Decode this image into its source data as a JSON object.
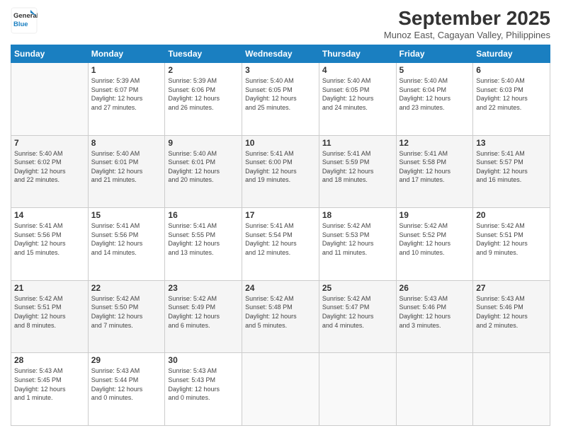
{
  "header": {
    "logo_line1": "General",
    "logo_line2": "Blue",
    "month_title": "September 2025",
    "subtitle": "Munoz East, Cagayan Valley, Philippines"
  },
  "columns": [
    "Sunday",
    "Monday",
    "Tuesday",
    "Wednesday",
    "Thursday",
    "Friday",
    "Saturday"
  ],
  "weeks": [
    [
      {
        "day": "",
        "info": ""
      },
      {
        "day": "1",
        "info": "Sunrise: 5:39 AM\nSunset: 6:07 PM\nDaylight: 12 hours\nand 27 minutes."
      },
      {
        "day": "2",
        "info": "Sunrise: 5:39 AM\nSunset: 6:06 PM\nDaylight: 12 hours\nand 26 minutes."
      },
      {
        "day": "3",
        "info": "Sunrise: 5:40 AM\nSunset: 6:05 PM\nDaylight: 12 hours\nand 25 minutes."
      },
      {
        "day": "4",
        "info": "Sunrise: 5:40 AM\nSunset: 6:05 PM\nDaylight: 12 hours\nand 24 minutes."
      },
      {
        "day": "5",
        "info": "Sunrise: 5:40 AM\nSunset: 6:04 PM\nDaylight: 12 hours\nand 23 minutes."
      },
      {
        "day": "6",
        "info": "Sunrise: 5:40 AM\nSunset: 6:03 PM\nDaylight: 12 hours\nand 22 minutes."
      }
    ],
    [
      {
        "day": "7",
        "info": "Sunrise: 5:40 AM\nSunset: 6:02 PM\nDaylight: 12 hours\nand 22 minutes."
      },
      {
        "day": "8",
        "info": "Sunrise: 5:40 AM\nSunset: 6:01 PM\nDaylight: 12 hours\nand 21 minutes."
      },
      {
        "day": "9",
        "info": "Sunrise: 5:40 AM\nSunset: 6:01 PM\nDaylight: 12 hours\nand 20 minutes."
      },
      {
        "day": "10",
        "info": "Sunrise: 5:41 AM\nSunset: 6:00 PM\nDaylight: 12 hours\nand 19 minutes."
      },
      {
        "day": "11",
        "info": "Sunrise: 5:41 AM\nSunset: 5:59 PM\nDaylight: 12 hours\nand 18 minutes."
      },
      {
        "day": "12",
        "info": "Sunrise: 5:41 AM\nSunset: 5:58 PM\nDaylight: 12 hours\nand 17 minutes."
      },
      {
        "day": "13",
        "info": "Sunrise: 5:41 AM\nSunset: 5:57 PM\nDaylight: 12 hours\nand 16 minutes."
      }
    ],
    [
      {
        "day": "14",
        "info": "Sunrise: 5:41 AM\nSunset: 5:56 PM\nDaylight: 12 hours\nand 15 minutes."
      },
      {
        "day": "15",
        "info": "Sunrise: 5:41 AM\nSunset: 5:56 PM\nDaylight: 12 hours\nand 14 minutes."
      },
      {
        "day": "16",
        "info": "Sunrise: 5:41 AM\nSunset: 5:55 PM\nDaylight: 12 hours\nand 13 minutes."
      },
      {
        "day": "17",
        "info": "Sunrise: 5:41 AM\nSunset: 5:54 PM\nDaylight: 12 hours\nand 12 minutes."
      },
      {
        "day": "18",
        "info": "Sunrise: 5:42 AM\nSunset: 5:53 PM\nDaylight: 12 hours\nand 11 minutes."
      },
      {
        "day": "19",
        "info": "Sunrise: 5:42 AM\nSunset: 5:52 PM\nDaylight: 12 hours\nand 10 minutes."
      },
      {
        "day": "20",
        "info": "Sunrise: 5:42 AM\nSunset: 5:51 PM\nDaylight: 12 hours\nand 9 minutes."
      }
    ],
    [
      {
        "day": "21",
        "info": "Sunrise: 5:42 AM\nSunset: 5:51 PM\nDaylight: 12 hours\nand 8 minutes."
      },
      {
        "day": "22",
        "info": "Sunrise: 5:42 AM\nSunset: 5:50 PM\nDaylight: 12 hours\nand 7 minutes."
      },
      {
        "day": "23",
        "info": "Sunrise: 5:42 AM\nSunset: 5:49 PM\nDaylight: 12 hours\nand 6 minutes."
      },
      {
        "day": "24",
        "info": "Sunrise: 5:42 AM\nSunset: 5:48 PM\nDaylight: 12 hours\nand 5 minutes."
      },
      {
        "day": "25",
        "info": "Sunrise: 5:42 AM\nSunset: 5:47 PM\nDaylight: 12 hours\nand 4 minutes."
      },
      {
        "day": "26",
        "info": "Sunrise: 5:43 AM\nSunset: 5:46 PM\nDaylight: 12 hours\nand 3 minutes."
      },
      {
        "day": "27",
        "info": "Sunrise: 5:43 AM\nSunset: 5:46 PM\nDaylight: 12 hours\nand 2 minutes."
      }
    ],
    [
      {
        "day": "28",
        "info": "Sunrise: 5:43 AM\nSunset: 5:45 PM\nDaylight: 12 hours\nand 1 minute."
      },
      {
        "day": "29",
        "info": "Sunrise: 5:43 AM\nSunset: 5:44 PM\nDaylight: 12 hours\nand 0 minutes."
      },
      {
        "day": "30",
        "info": "Sunrise: 5:43 AM\nSunset: 5:43 PM\nDaylight: 12 hours\nand 0 minutes."
      },
      {
        "day": "",
        "info": ""
      },
      {
        "day": "",
        "info": ""
      },
      {
        "day": "",
        "info": ""
      },
      {
        "day": "",
        "info": ""
      }
    ]
  ]
}
